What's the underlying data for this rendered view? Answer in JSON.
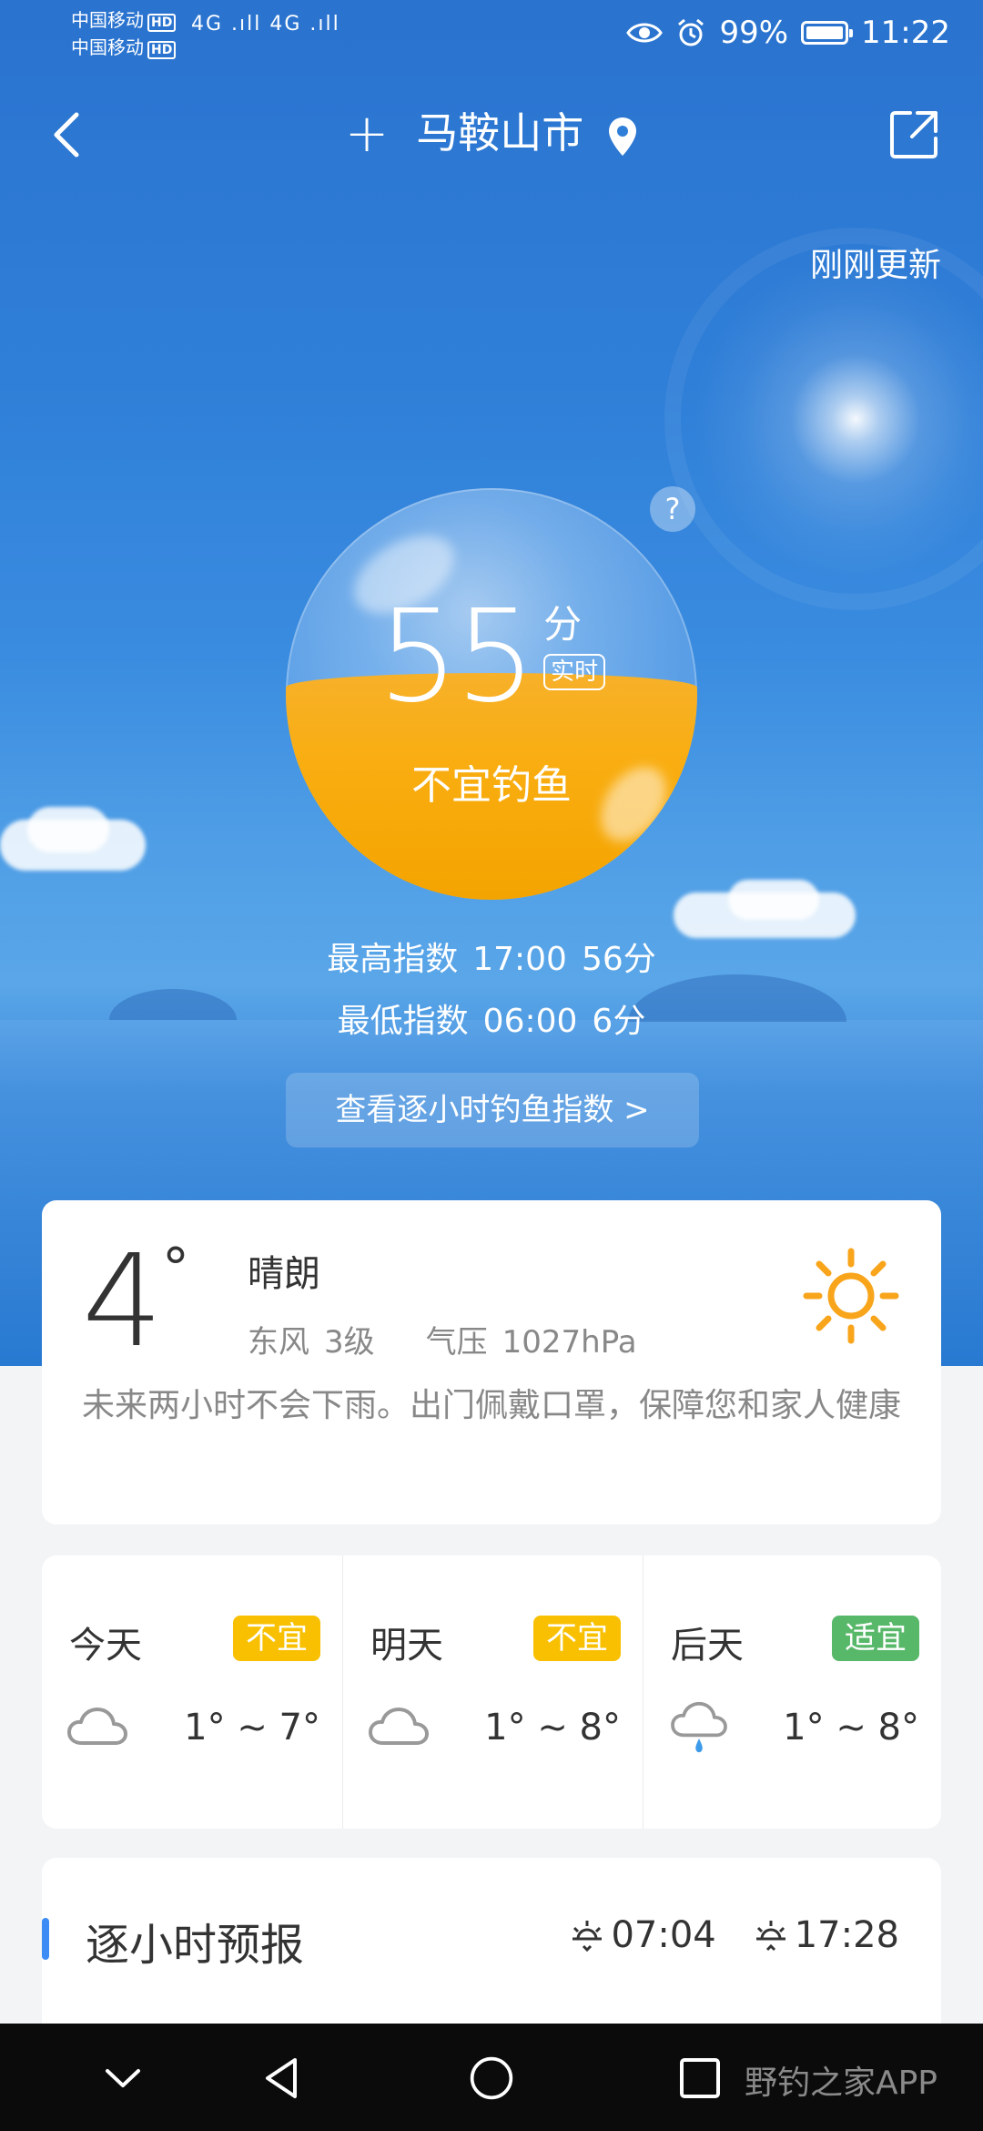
{
  "status": {
    "carrier1": "中国移动",
    "carrier2": "中国移动",
    "hd": "HD",
    "signal": "4G .ıll 4G .ıll",
    "battery": "99%",
    "time": "11:22"
  },
  "nav": {
    "city": "马鞍山市"
  },
  "hero": {
    "updated": "刚刚更新",
    "help": "?",
    "score": "55",
    "score_unit": "分",
    "score_tag": "实时",
    "score_fill": 0.55,
    "verdict": "不宜钓鱼",
    "high_label": "最高指数",
    "high_time": "17:00",
    "high_value": "56分",
    "low_label": "最低指数",
    "low_time": "06:00",
    "low_value": "6分",
    "hourly_button": "查看逐小时钓鱼指数 >"
  },
  "current": {
    "temp": "4",
    "deg": "°",
    "condition": "晴朗",
    "wind": "东风",
    "wind_level": "3级",
    "pressure_label": "气压",
    "pressure": "1027hPa",
    "advice": "未来两小时不会下雨。出门佩戴口罩，保障您和家人健康",
    "icon": "sun-icon"
  },
  "days": [
    {
      "name": "今天",
      "tag": "不宜",
      "tag_color": "#f8c000",
      "icon": "cloud-icon",
      "temp": "1° ~ 7°"
    },
    {
      "name": "明天",
      "tag": "不宜",
      "tag_color": "#f8c000",
      "icon": "cloud-icon",
      "temp": "1° ~ 8°"
    },
    {
      "name": "后天",
      "tag": "适宜",
      "tag_color": "#58b86a",
      "icon": "rain-cloud-icon",
      "temp": "1° ~ 8°"
    }
  ],
  "hourly": {
    "title": "逐小时预报",
    "sunrise": "07:04",
    "sunset": "17:28"
  },
  "colors": {
    "accent": "#3d8bf5",
    "gauge": "#f9ad10",
    "sun": "#f8a51c"
  },
  "watermark": "野钓之家APP"
}
